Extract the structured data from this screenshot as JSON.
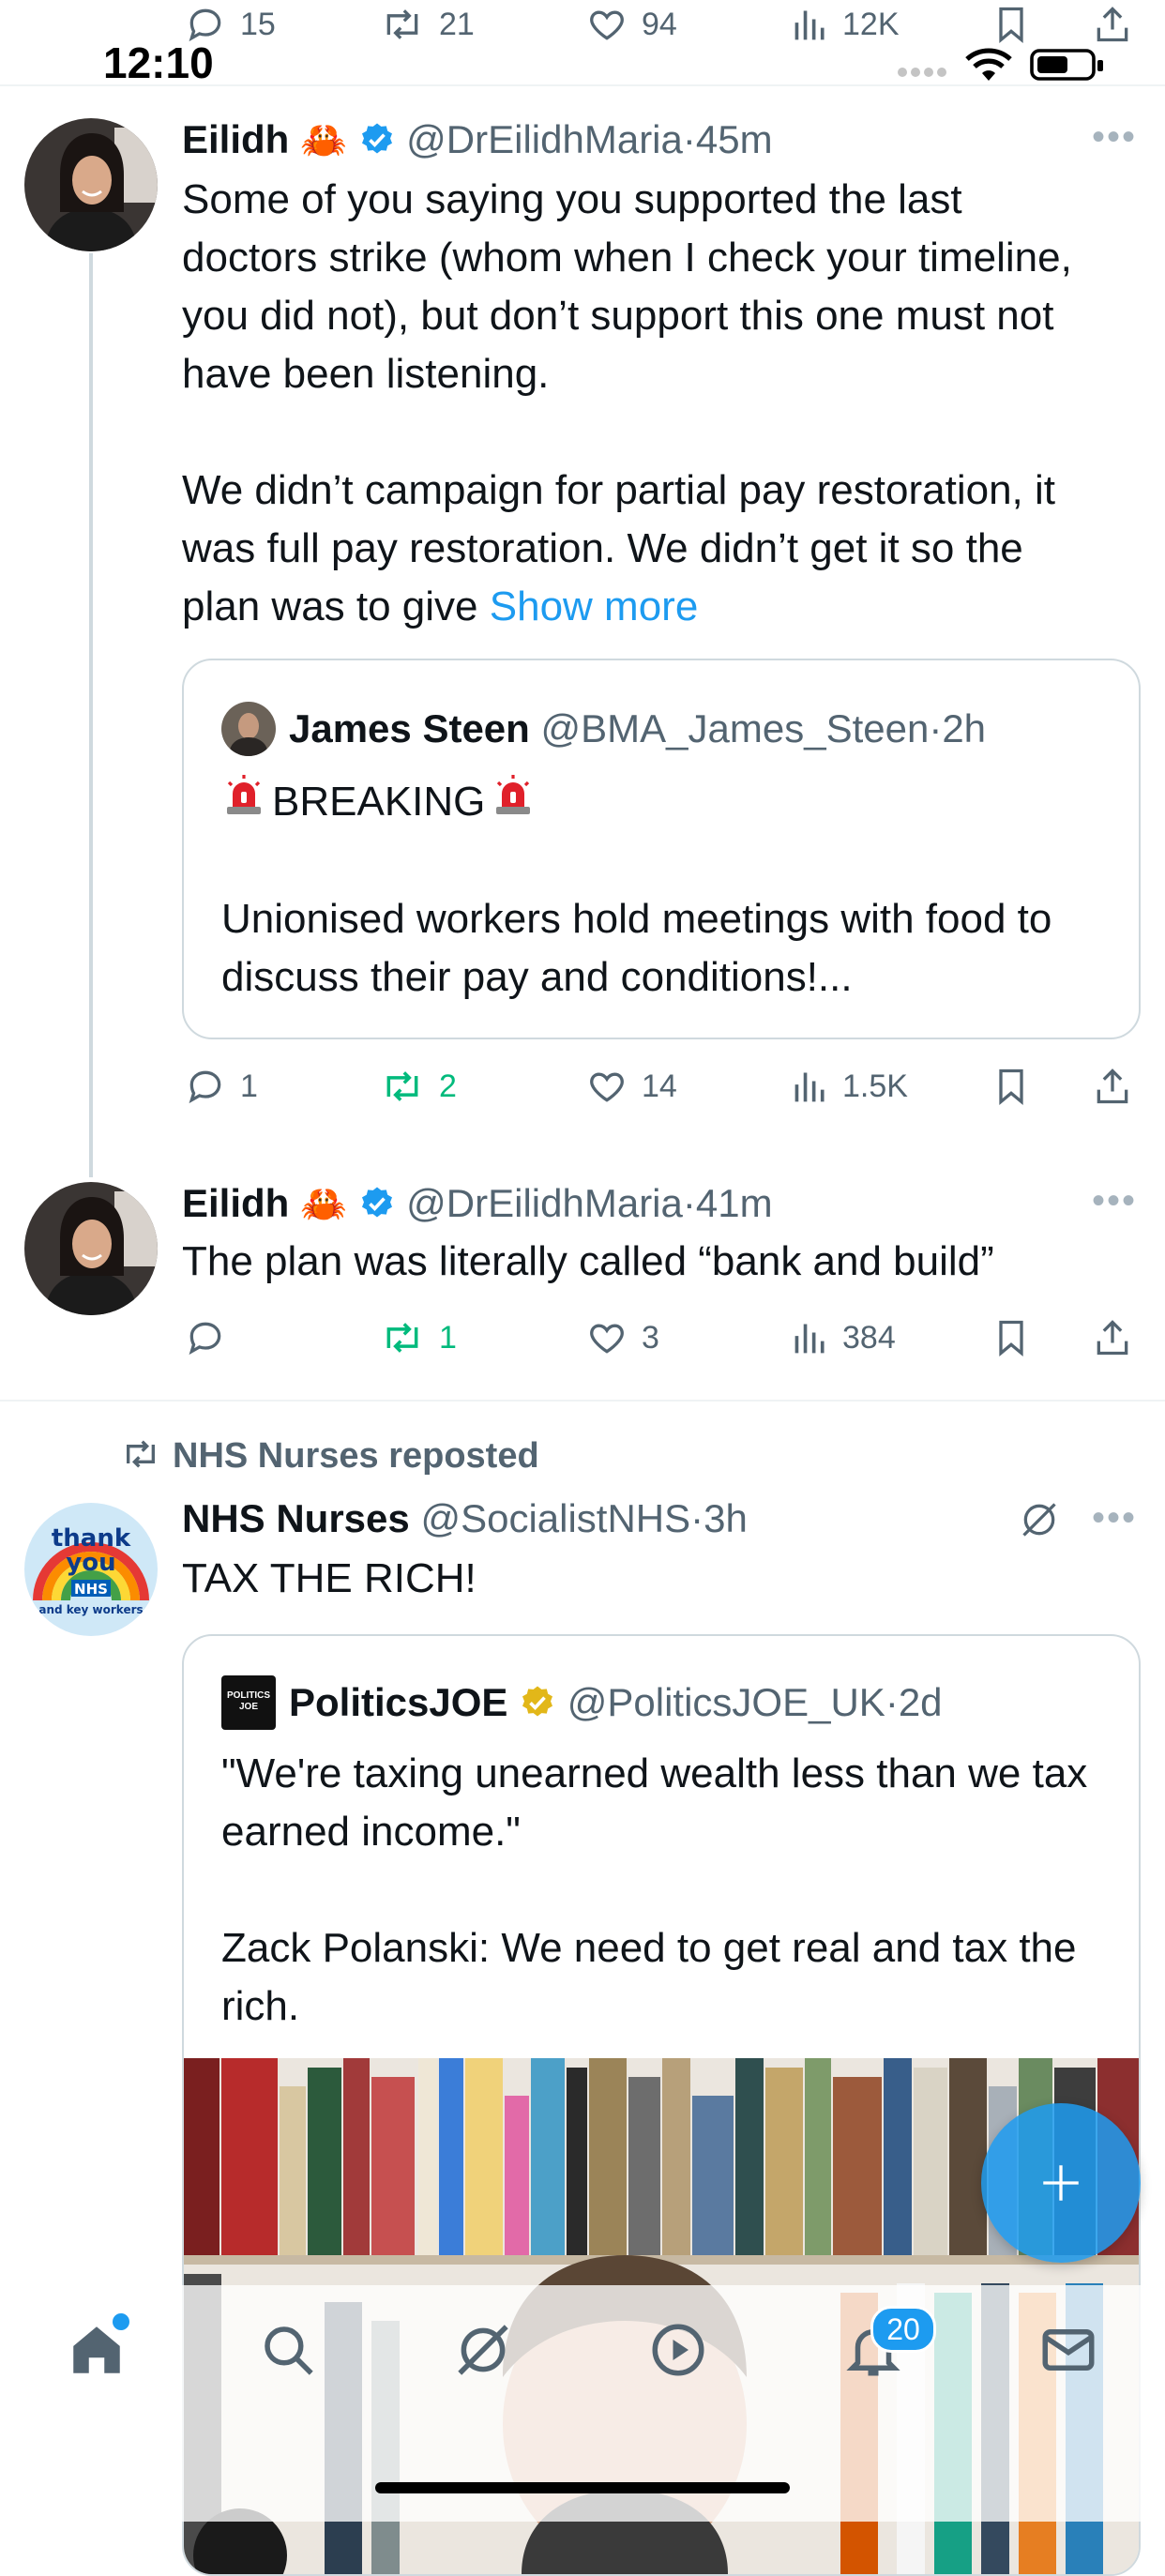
{
  "status_bar": {
    "time": "12:10"
  },
  "top_actions": {
    "replies": "15",
    "reposts": "21",
    "likes": "94",
    "views": "12K"
  },
  "tweet1": {
    "author_name": "Eilidh",
    "author_emoji": "🦀",
    "handle": "@DrEilidhMaria",
    "time": "45m",
    "text_p1": "Some of you saying you supported the last doctors strike (whom when I check your timeline, you did not), but don’t support this one must not have been listening.",
    "text_p2": "We didn’t campaign for partial pay restoration, it was full pay restoration. We didn’t get it so the plan was to give",
    "show_more": "Show more",
    "quote": {
      "author_name": "James Steen",
      "handle": "@BMA_James_Steen",
      "time": "2h",
      "line1": "BREAKING",
      "line2": "Unionised workers hold meetings with food to discuss their pay and conditions!..."
    },
    "actions": {
      "replies": "1",
      "reposts": "2",
      "likes": "14",
      "views": "1.5K"
    }
  },
  "tweet2": {
    "author_name": "Eilidh",
    "author_emoji": "🦀",
    "handle": "@DrEilidhMaria",
    "time": "41m",
    "text": "The plan was literally called “bank and build”",
    "actions": {
      "replies": "",
      "reposts": "1",
      "likes": "3",
      "views": "384"
    }
  },
  "tweet3": {
    "repost_label": "NHS Nurses reposted",
    "author_name": "NHS Nurses",
    "handle": "@SocialistNHS",
    "time": "3h",
    "text": "TAX THE RICH!",
    "avatar_text": {
      "line1": "thank",
      "line2": "you",
      "line3": "NHS",
      "line4": "and key workers"
    },
    "quote": {
      "author_name": "PoliticsJOE",
      "logo_text": "POLITICS JOE",
      "handle": "@PoliticsJOE_UK",
      "time": "2d",
      "p1": "\"We're taxing unearned wealth less than we tax earned income.\"",
      "p2": "Zack Polanski: We need to get real and tax the rich."
    }
  },
  "fab": {
    "icon": "plus-icon"
  },
  "tabbar": {
    "notifications_badge": "20"
  },
  "colors": {
    "accent": "#1d9bf0",
    "repost_green": "#00ba7c",
    "muted": "#536471",
    "divider": "#eff3f4"
  }
}
